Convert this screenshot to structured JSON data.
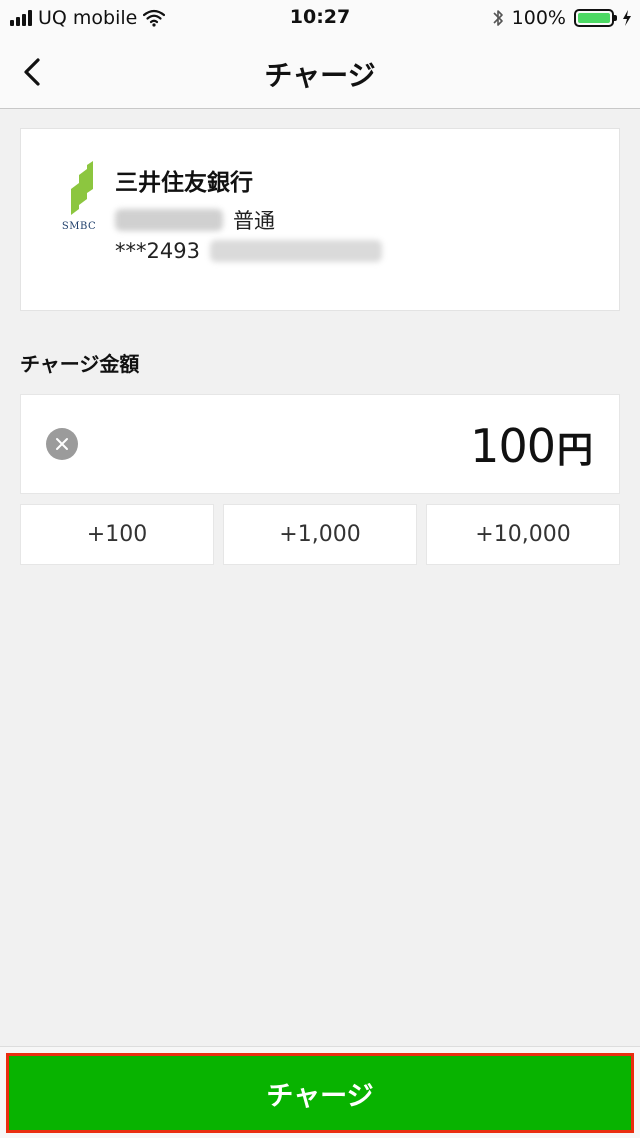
{
  "status_bar": {
    "carrier": "UQ mobile",
    "time": "10:27",
    "battery_percent": "100%",
    "battery_level": 1.0,
    "icons": [
      "signal-icon",
      "wifi-icon",
      "bluetooth-icon",
      "battery-icon",
      "charging-icon"
    ]
  },
  "nav": {
    "title": "チャージ",
    "back_icon": "chevron-left-icon"
  },
  "bank": {
    "logo_text": "SMBC",
    "name": "三井住友銀行",
    "account_type": "普通",
    "account_number": "***2493",
    "colors": {
      "logo_green": "#8cc63f",
      "logo_text": "#1f3f6b"
    }
  },
  "charge": {
    "section_label": "チャージ金額",
    "amount": "100",
    "unit": "円",
    "clear_icon": "clear-icon",
    "quick_add": [
      {
        "label": "+100"
      },
      {
        "label": "+1,000"
      },
      {
        "label": "+10,000"
      }
    ],
    "button_label": "チャージ",
    "colors": {
      "button_bg": "#08b300",
      "highlight_border": "#ea2e10"
    }
  }
}
